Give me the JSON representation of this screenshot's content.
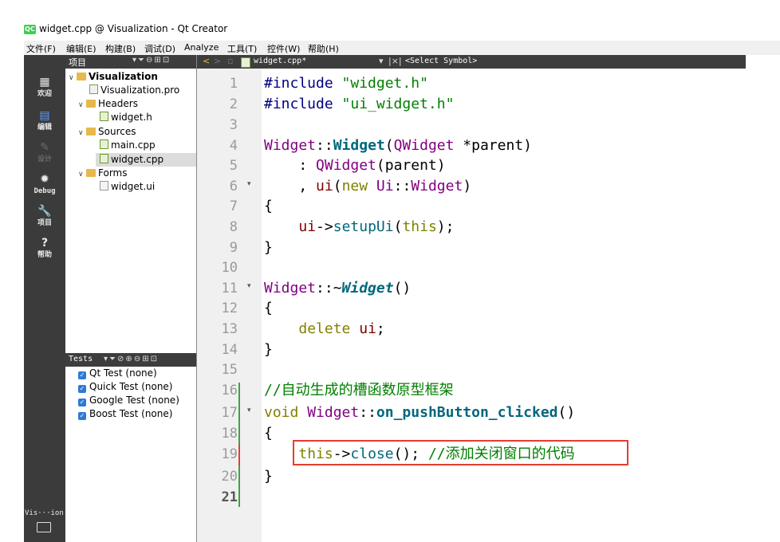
{
  "window": {
    "icon": "QC",
    "title": "widget.cpp @ Visualization - Qt Creator"
  },
  "menu": [
    "文件(F)",
    "编辑(E)",
    "构建(B)",
    "调试(D)",
    "Analyze",
    "工具(T)",
    "控件(W)",
    "帮助(H)"
  ],
  "modes": [
    {
      "icon": "grid-icon",
      "glyph": "▦",
      "label": "欢迎"
    },
    {
      "icon": "edit-icon",
      "glyph": "▤",
      "label": "编辑"
    },
    {
      "icon": "design-icon",
      "glyph": "✎",
      "label": "设计"
    },
    {
      "icon": "debug-icon",
      "glyph": "✹",
      "label": "Debug"
    },
    {
      "icon": "wrench-icon",
      "glyph": "🔧",
      "label": "项目"
    },
    {
      "icon": "help-icon",
      "glyph": "?",
      "label": "帮助"
    }
  ],
  "bottom_mode": {
    "label": "Vis···ion",
    "icon": "monitor-icon"
  },
  "project": {
    "header": "项目",
    "tree": [
      {
        "label": "Visualization",
        "level": 0,
        "icon": "folder-icon",
        "expanded": true,
        "bold": true
      },
      {
        "label": "Visualization.pro",
        "level": 1,
        "icon": "pro-file-icon"
      },
      {
        "label": "Headers",
        "level": 1,
        "icon": "folder-icon",
        "expanded": true
      },
      {
        "label": "widget.h",
        "level": 2,
        "icon": "header-file-icon"
      },
      {
        "label": "Sources",
        "level": 1,
        "icon": "folder-icon",
        "expanded": true
      },
      {
        "label": "main.cpp",
        "level": 2,
        "icon": "cpp-file-icon"
      },
      {
        "label": "widget.cpp",
        "level": 2,
        "icon": "cpp-file-icon",
        "selected": true
      },
      {
        "label": "Forms",
        "level": 1,
        "icon": "folder-icon",
        "expanded": true
      },
      {
        "label": "widget.ui",
        "level": 2,
        "icon": "ui-file-icon"
      }
    ]
  },
  "tests": {
    "header": "Tests",
    "items": [
      "Qt Test (none)",
      "Quick Test (none)",
      "Google Test (none)",
      "Boost Test (none)"
    ]
  },
  "editor": {
    "file_tab": "widget.cpp*",
    "symbol": "<Select Symbol>",
    "lines": [
      "1",
      "2",
      "3",
      "4",
      "5",
      "6",
      "7",
      "8",
      "9",
      "10",
      "11",
      "12",
      "13",
      "14",
      "15",
      "16",
      "17",
      "18",
      "19",
      "20",
      "21"
    ],
    "code": {
      "l1_a": "#include",
      "l1_b": " \"widget.h\"",
      "l2_a": "#include",
      "l2_b": " \"ui_widget.h\"",
      "l4_a": "Widget",
      "l4_b": "::",
      "l4_c": "Widget",
      "l4_d": "(",
      "l4_e": "QWidget",
      "l4_f": " *parent)",
      "l5_a": "    : ",
      "l5_b": "QWidget",
      "l5_c": "(parent)",
      "l6_a": "    , ",
      "l6_b": "ui",
      "l6_c": "(",
      "l6_d": "new",
      "l6_e": " ",
      "l6_f": "Ui",
      "l6_g": "::",
      "l6_h": "Widget",
      "l6_i": ")",
      "l7": "{",
      "l8_a": "    ",
      "l8_b": "ui",
      "l8_c": "->",
      "l8_d": "setupUi",
      "l8_e": "(",
      "l8_f": "this",
      "l8_g": ");",
      "l9": "}",
      "l11_a": "Widget",
      "l11_b": "::~",
      "l11_c": "Widget",
      "l11_d": "()",
      "l12": "{",
      "l13_a": "    ",
      "l13_b": "delete",
      "l13_c": " ",
      "l13_d": "ui",
      "l13_e": ";",
      "l14": "}",
      "l16": "//自动生成的槽函数原型框架",
      "l17_a": "void",
      "l17_b": " ",
      "l17_c": "Widget",
      "l17_d": "::",
      "l17_e": "on_pushButton_clicked",
      "l17_f": "()",
      "l18": "{",
      "l19_a": "    ",
      "l19_b": "this",
      "l19_c": "->",
      "l19_d": "close",
      "l19_e": "(); ",
      "l19_f": "//添加关闭窗口的代码",
      "l20": "}"
    }
  },
  "colors": {
    "keyword": "#808000",
    "string": "#008000",
    "class": "#800080",
    "function": "#00677c",
    "highlight": "#e53d2f"
  }
}
